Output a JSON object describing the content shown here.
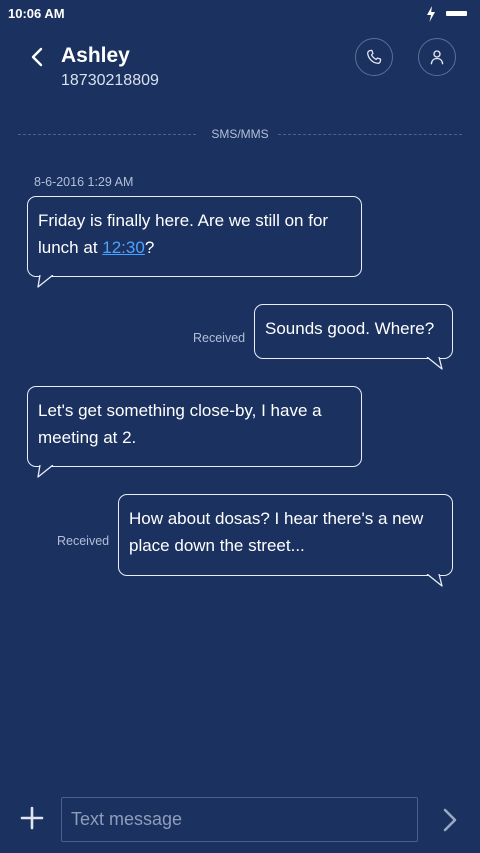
{
  "status_bar": {
    "time": "10:06 AM",
    "icons": [
      "charging-bolt-icon",
      "battery-icon"
    ]
  },
  "header": {
    "back_icon": "chevron-left-icon",
    "contact_name": "Ashley",
    "contact_number": "18730218809",
    "call_icon": "phone-icon",
    "profile_icon": "person-icon"
  },
  "thread": {
    "channel_label": "SMS/MMS",
    "timestamp": "8-6-2016 1:29 AM",
    "messages": [
      {
        "direction": "incoming",
        "text_before": "Friday is finally here. Are we still on for lunch at ",
        "link": "12:30",
        "text_after": "?"
      },
      {
        "direction": "outgoing",
        "status": "Received",
        "text": "Sounds good. Where?"
      },
      {
        "direction": "incoming",
        "text": "Let's get something close-by, I have a meeting at 2."
      },
      {
        "direction": "outgoing",
        "status": "Received",
        "text": "How about dosas? I hear there's a new place down the street..."
      }
    ]
  },
  "composer": {
    "attach_icon": "plus-icon",
    "placeholder": "Text message",
    "value": "",
    "send_icon": "send-chevron-icon"
  },
  "colors": {
    "background": "#1b3160",
    "bubble_border": "#e9eef8",
    "link": "#4aa3ff",
    "muted_text": "#b3bfd6"
  }
}
